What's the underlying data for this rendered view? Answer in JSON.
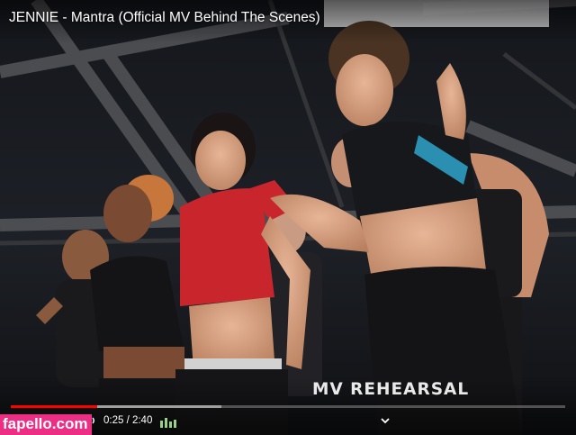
{
  "video": {
    "title": "JENNIE - Mantra (Official MV Behind The Scenes)",
    "overlay_caption": "MV REHEARSAL",
    "time_display": "0:25 / 2:40",
    "progress_fraction": 0.156,
    "buffered_fraction": 0.38
  },
  "watermark": {
    "text": "fapello.com"
  },
  "icons": {
    "volume": "volume-icon",
    "chapter": "chevron-down-icon"
  },
  "colors": {
    "progress": "#ff0000",
    "watermark_bg": "#ec2f85"
  }
}
